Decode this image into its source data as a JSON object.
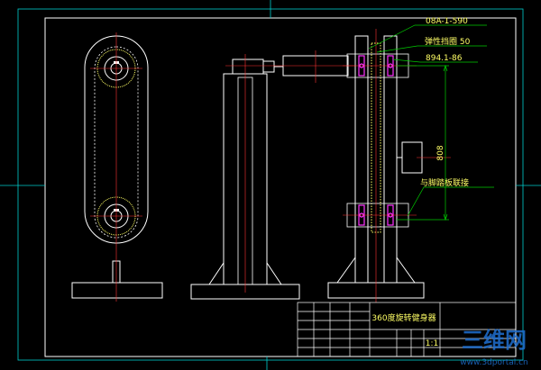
{
  "annotations": {
    "chain_no": "08A-1-590",
    "circlip": "弹性挡圈 50",
    "standard": "894.1-86",
    "dimension": "808",
    "pedal_link": "与脚踏板联接"
  },
  "title_block": {
    "title": "360度旋转健身器",
    "scale": "1:1"
  },
  "watermark": {
    "logo": "三维网",
    "url": "www.3dportal.cn"
  },
  "colors": {
    "background": "#000000",
    "outline": "#ffffff",
    "border": "#00cccc",
    "centerline": "#ff3333",
    "text": "#ffff66",
    "dimension": "#00cc00",
    "part": "#ff33ff",
    "sprocket": "#ffff66",
    "watermark": "#1f6fd0"
  }
}
